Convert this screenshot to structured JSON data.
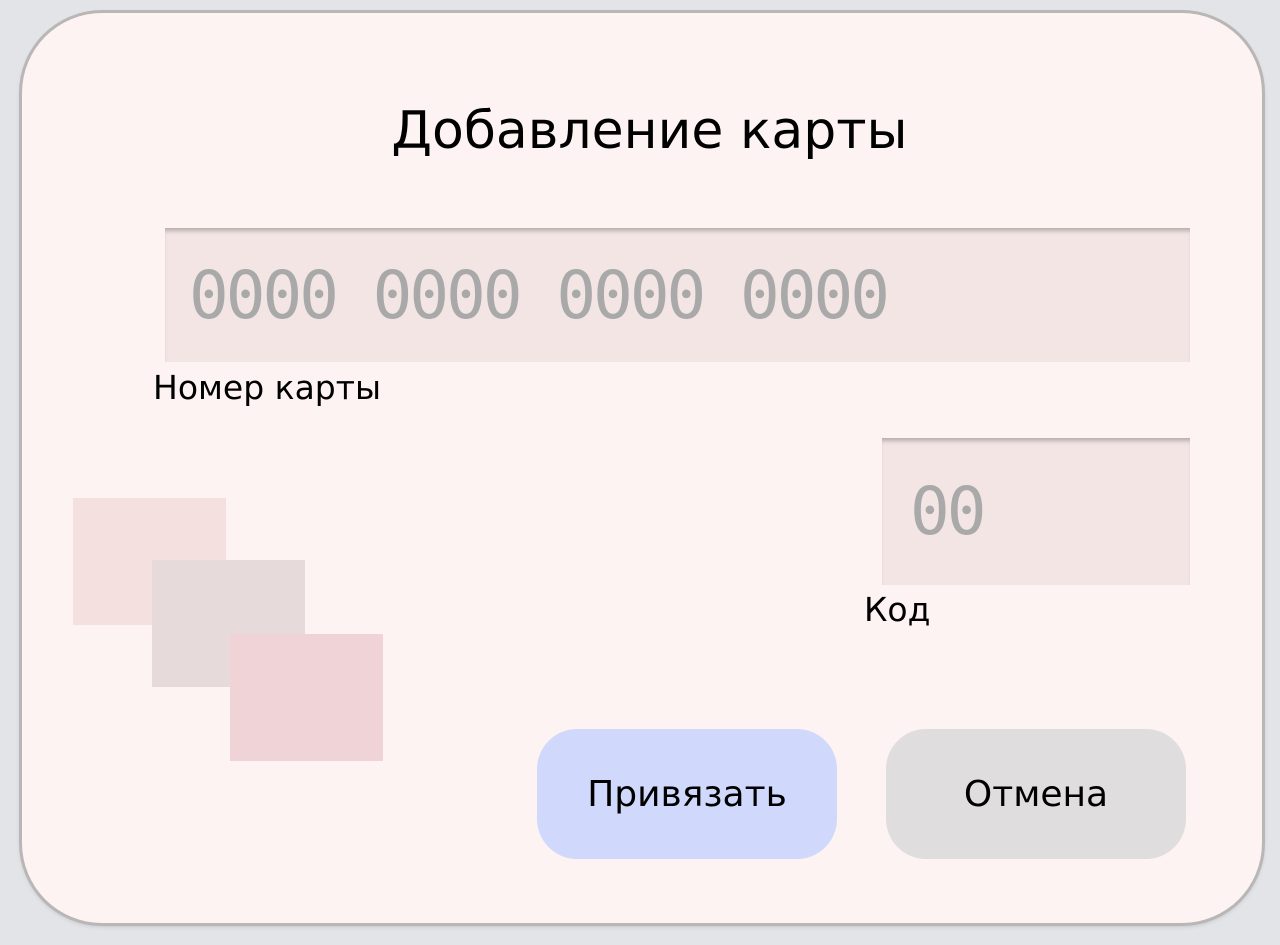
{
  "dialog": {
    "title": "Добавление карты",
    "card_number": {
      "placeholder": "0000 0000 0000 0000",
      "label": "Номер карты"
    },
    "code": {
      "placeholder": "00",
      "label": "Код"
    },
    "buttons": {
      "bind": "Привязать",
      "cancel": "Отмена"
    },
    "colors": {
      "bind_button": "#d0d9fb",
      "cancel_button": "#dfdddd",
      "background": "#fdf3f2"
    }
  }
}
